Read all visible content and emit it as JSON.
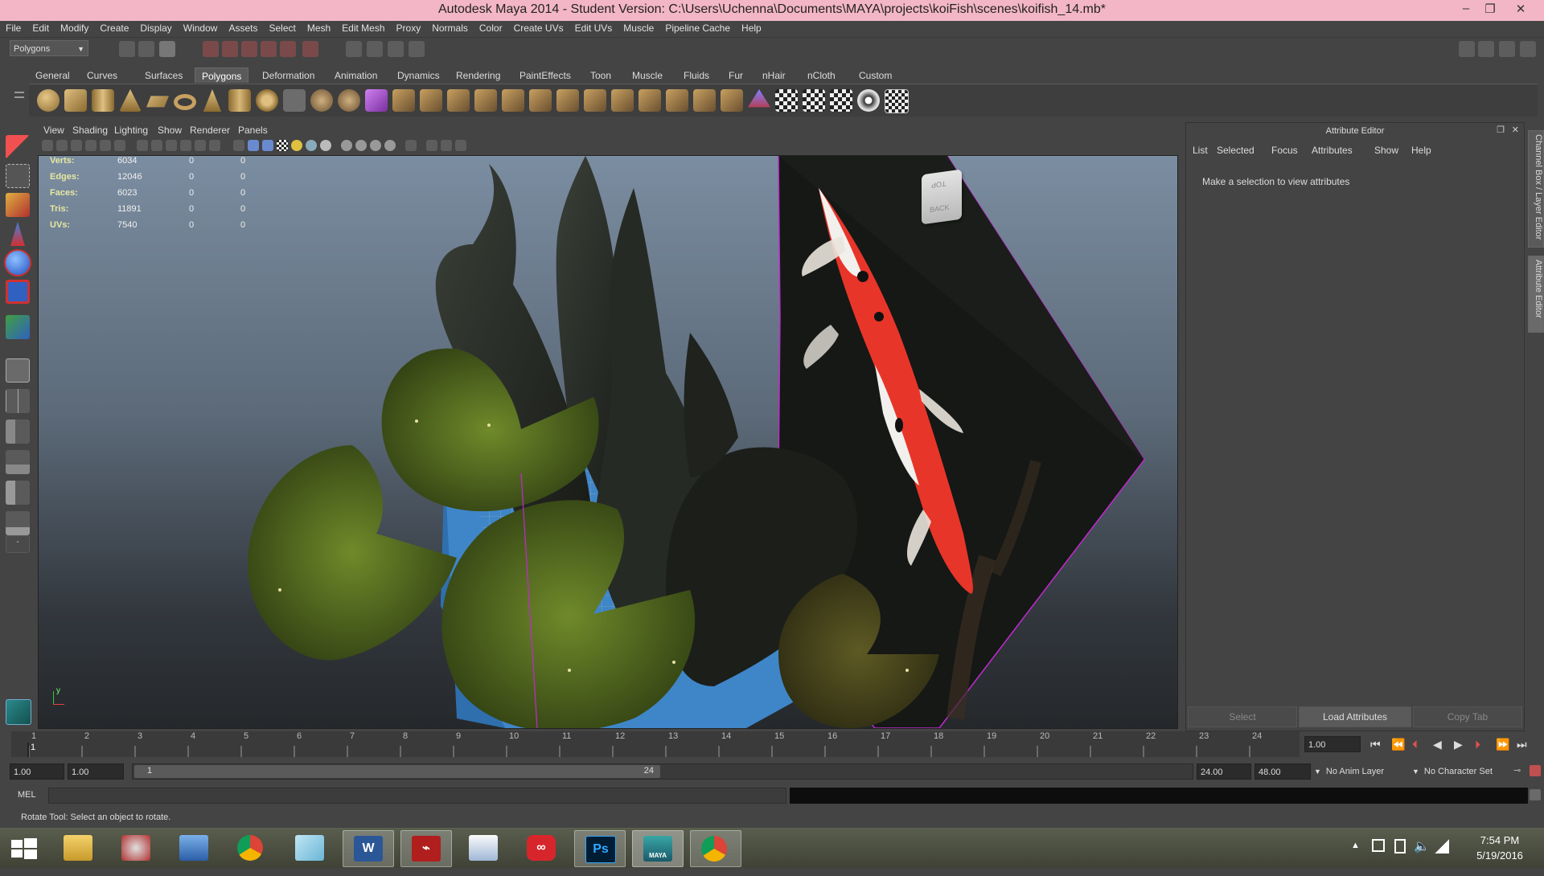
{
  "window": {
    "title": "Autodesk Maya 2014 - Student Version: C:\\Users\\Uchenna\\Documents\\MAYA\\projects\\koiFish\\scenes\\koifish_14.mb*",
    "minimize_glyph": "–",
    "maximize_glyph": "❐",
    "close_glyph": "✕"
  },
  "menubar": [
    "File",
    "Edit",
    "Modify",
    "Create",
    "Display",
    "Window",
    "Assets",
    "Select",
    "Mesh",
    "Edit Mesh",
    "Proxy",
    "Normals",
    "Color",
    "Create UVs",
    "Edit UVs",
    "Muscle",
    "Pipeline Cache",
    "Help"
  ],
  "statusline": {
    "menuset": "Polygons"
  },
  "shelf": {
    "tabs": [
      "General",
      "Curves",
      "Surfaces",
      "Polygons",
      "Deformation",
      "Animation",
      "Dynamics",
      "Rendering",
      "PaintEffects",
      "Toon",
      "Muscle",
      "Fluids",
      "Fur",
      "nHair",
      "nCloth",
      "Custom"
    ],
    "active_tab": "Polygons"
  },
  "viewport": {
    "menu": [
      "View",
      "Shading",
      "Lighting",
      "Show",
      "Renderer",
      "Panels"
    ],
    "hud": [
      {
        "label": "Verts:",
        "values": [
          "6034",
          "0",
          "0"
        ]
      },
      {
        "label": "Edges:",
        "values": [
          "12046",
          "0",
          "0"
        ]
      },
      {
        "label": "Faces:",
        "values": [
          "6023",
          "0",
          "0"
        ]
      },
      {
        "label": "Tris:",
        "values": [
          "11891",
          "0",
          "0"
        ]
      },
      {
        "label": "UVs:",
        "values": [
          "7540",
          "0",
          "0"
        ]
      }
    ],
    "viewcube": {
      "top": "TOP",
      "back": "BACK"
    },
    "axis_label": "y"
  },
  "attribute_editor": {
    "title": "Attribute Editor",
    "menu": [
      "List",
      "Selected",
      "Focus",
      "Attributes",
      "Show",
      "Help"
    ],
    "message": "Make a selection to view attributes",
    "buttons": {
      "select": "Select",
      "load": "Load Attributes",
      "copy": "Copy Tab"
    },
    "side_tabs": [
      "Channel Box / Layer Editor",
      "Attribute Editor"
    ]
  },
  "timeslider": {
    "frames": [
      "1",
      "2",
      "3",
      "4",
      "5",
      "6",
      "7",
      "8",
      "9",
      "10",
      "11",
      "12",
      "13",
      "14",
      "15",
      "16",
      "17",
      "18",
      "19",
      "20",
      "21",
      "22",
      "23",
      "24"
    ],
    "current_frame": "1",
    "current_time_field": "1.00"
  },
  "rangeslider": {
    "start_time": "1.00",
    "playback_start": "1.00",
    "range_start_label": "1",
    "range_end_label": "24",
    "playback_end": "24.00",
    "end_time": "48.00",
    "anim_layer": "No Anim Layer",
    "character_set": "No Character Set"
  },
  "commandline": {
    "label": "MEL"
  },
  "helpline": {
    "text": "Rotate Tool: Select an object to rotate."
  },
  "taskbar": {
    "apps": [
      "start",
      "file-explorer",
      "snipping-tool",
      "remote-desktop",
      "chrome",
      "notepad",
      "word",
      "acrobat",
      "wordpad",
      "creative-cloud",
      "photoshop",
      "maya",
      "chrome"
    ],
    "word_glyph": "W",
    "ps_glyph": "Ps",
    "maya_glyph": "MAYA",
    "time": "7:54 PM",
    "date": "5/19/2016"
  },
  "colors": {
    "title_bar": "#f3b6c7",
    "ui_bg": "#444444",
    "hud_label": "#e8e8a0",
    "object_outline": "#c02ad0"
  }
}
